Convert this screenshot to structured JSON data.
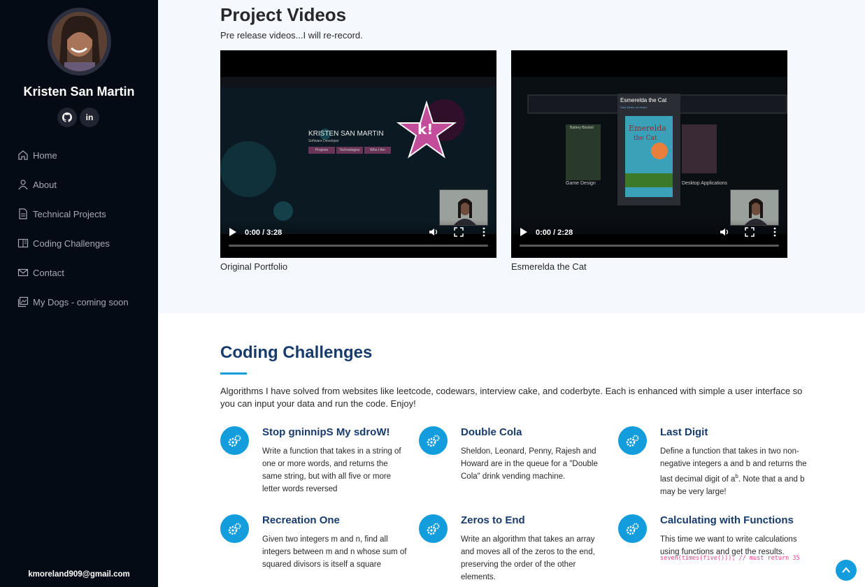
{
  "profile": {
    "name": "Kristen San Martin",
    "email": "kmoreland909@gmail.com",
    "social": [
      {
        "icon": "github-icon",
        "label": ""
      },
      {
        "icon": "linkedin-icon",
        "label": "in"
      }
    ]
  },
  "nav": {
    "items": [
      {
        "label": "Home",
        "icon": "home-icon"
      },
      {
        "label": "About",
        "icon": "person-icon"
      },
      {
        "label": "Technical Projects",
        "icon": "file-icon"
      },
      {
        "label": "Coding Challenges",
        "icon": "book-icon"
      },
      {
        "label": "Contact",
        "icon": "envelope-icon"
      },
      {
        "label": "My Dogs - coming soon",
        "icon": "images-icon"
      }
    ]
  },
  "videos": {
    "title": "Project Videos",
    "subtitle": "Pre release videos...I will re-record.",
    "items": [
      {
        "caption": "Original Portfolio",
        "time": "0:00 / 3:28",
        "preview": {
          "name": "KRISTEN SAN MARTIN",
          "role": "Software Developer",
          "buttons": [
            "Projects",
            "Technologies",
            "Who I Am"
          ]
        }
      },
      {
        "caption": "Esmerelda the Cat",
        "time": "0:00 / 2:28",
        "preview": {
          "popup_title": "Esmerelda the Cat",
          "popup_sub": "View Demo on Vimeo",
          "left_card": "Game Design",
          "right_card": "Desktop Applications",
          "left_card_title": "Battery Bicebol"
        }
      }
    ]
  },
  "coding": {
    "title": "Coding Challenges",
    "description": "Algorithms I have solved from websites like leetcode, codewars, interview cake, and coderbyte. Each is enhanced with simple a user interface so you can input your data and run the code. Enjoy!",
    "cards": [
      {
        "title": "Stop gninnipS My sdroW!",
        "desc": "Write a function that takes in a string of one or more words, and returns the same string, but with all five or more letter words reversed"
      },
      {
        "title": "Double Cola",
        "desc": "Sheldon, Leonard, Penny, Rajesh and Howard are in the queue for a \"Double Cola\" drink vending machine."
      },
      {
        "title": "Last Digit",
        "desc_before": "Define a function that takes in two non-negative integers a and b and returns the last decimal digit of a",
        "desc_sup": "b",
        "desc_after": ". Note that a and b may be very large!"
      },
      {
        "title": "Recreation One",
        "desc": "Given two integers m and n, find all integers between m and n whose sum of squared divisors is itself a square"
      },
      {
        "title": "Zeros to End",
        "desc": "Write an algorithm that takes an array and moves all of the zeros to the end, preserving the order of the other elements."
      },
      {
        "title": "Calculating with Functions",
        "desc": "This time we want to write calculations using functions and get the results.",
        "code": "seven(times(five())); // must return 35"
      }
    ],
    "icon": "gears-icon"
  },
  "colors": {
    "sidebar": "#040b14",
    "accent": "#149ddd",
    "heading": "#173b6c",
    "code": "#e83e8c"
  }
}
